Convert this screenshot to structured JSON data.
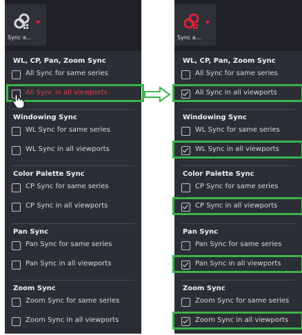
{
  "toolbar": {
    "left_label": "Sync a...",
    "right_label": "Sync a...",
    "icon": "link-sync-icon"
  },
  "left_menu": {
    "sections": [
      {
        "title": "WL, CP, Pan, Zoom Sync",
        "items": [
          {
            "label": "All Sync for same series",
            "checked": false
          },
          {
            "label": "All Sync in all viewports",
            "checked": false,
            "hover": true
          }
        ]
      },
      {
        "title": "Windowing Sync",
        "items": [
          {
            "label": "WL Sync for same series",
            "checked": false
          },
          {
            "label": "WL Sync in all viewports",
            "checked": false
          }
        ]
      },
      {
        "title": "Color Palette Sync",
        "items": [
          {
            "label": "CP Sync for same series",
            "checked": false
          },
          {
            "label": "CP Sync in all viewports",
            "checked": false
          }
        ]
      },
      {
        "title": "Pan Sync",
        "items": [
          {
            "label": "Pan Sync for same series",
            "checked": false
          },
          {
            "label": "Pan Sync in all viewports",
            "checked": false
          }
        ]
      },
      {
        "title": "Zoom Sync",
        "items": [
          {
            "label": "Zoom Sync for same series",
            "checked": false
          },
          {
            "label": "Zoom Sync in all viewports",
            "checked": false
          }
        ]
      }
    ]
  },
  "right_menu": {
    "sections": [
      {
        "title": "WL, CP, Pan, Zoom Sync",
        "items": [
          {
            "label": "All Sync for same series",
            "checked": false
          },
          {
            "label": "All Sync in all viewports",
            "checked": true
          }
        ]
      },
      {
        "title": "Windowing Sync",
        "items": [
          {
            "label": "WL Sync for same series",
            "checked": false
          },
          {
            "label": "WL Sync in all viewports",
            "checked": true
          }
        ]
      },
      {
        "title": "Color Palette Sync",
        "items": [
          {
            "label": "CP Sync for same series",
            "checked": false
          },
          {
            "label": "CP Sync in all viewports",
            "checked": true
          }
        ]
      },
      {
        "title": "Pan Sync",
        "items": [
          {
            "label": "Pan Sync for same series",
            "checked": false
          },
          {
            "label": "Pan Sync in all viewports",
            "checked": true
          }
        ]
      },
      {
        "title": "Zoom Sync",
        "items": [
          {
            "label": "Zoom Sync for same series",
            "checked": false
          },
          {
            "label": "Zoom Sync in all viewports",
            "checked": true
          }
        ]
      }
    ]
  },
  "colors": {
    "panel_bg": "#2b2e35",
    "toolbar_bg": "#1f2126",
    "highlight": "#3ab54a",
    "accent_red": "#e0203a"
  }
}
